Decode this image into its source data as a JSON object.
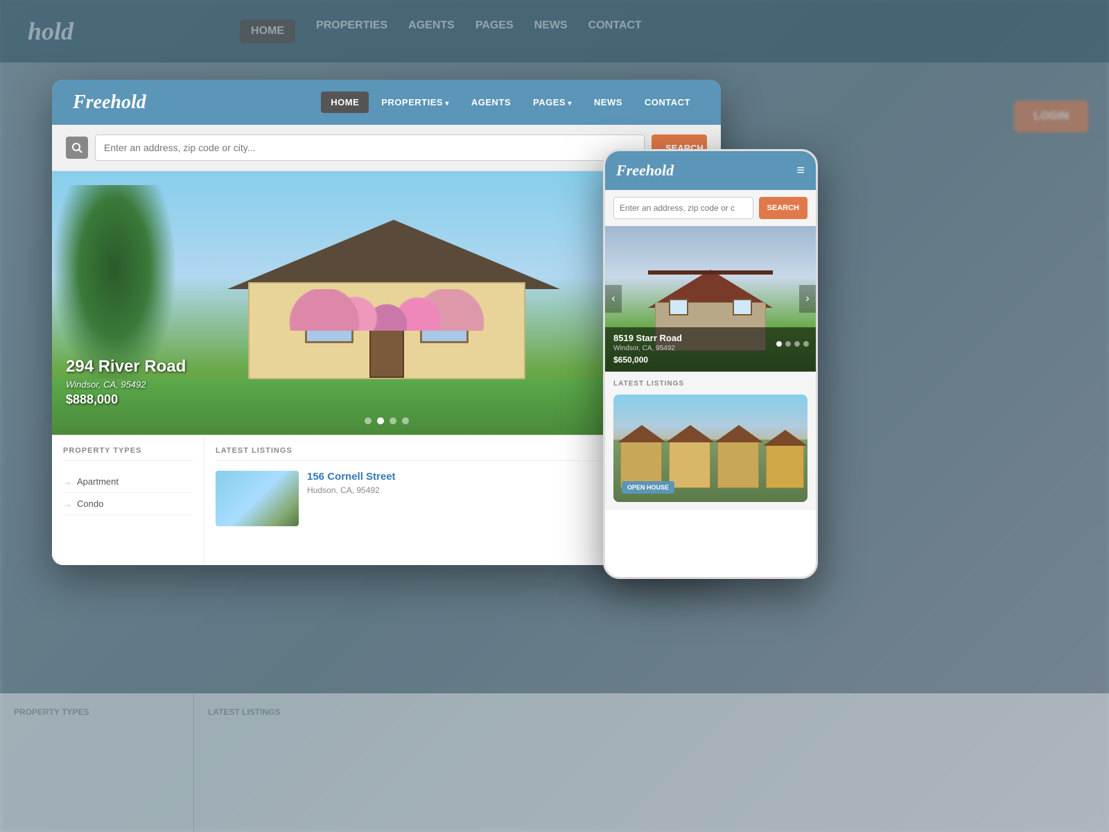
{
  "brand": {
    "name": "Freehold"
  },
  "background_nav": {
    "logo": "hold",
    "items": [
      {
        "label": "HOME",
        "active": true
      },
      {
        "label": "PROPERTIES",
        "has_arrow": true
      },
      {
        "label": "AGENTS"
      },
      {
        "label": "PAGES",
        "has_arrow": true
      },
      {
        "label": "NEWS"
      },
      {
        "label": "CONTACT"
      }
    ]
  },
  "desktop": {
    "nav": {
      "logo": "Freehold",
      "items": [
        {
          "label": "HOME",
          "active": true
        },
        {
          "label": "PROPERTIES",
          "has_arrow": true
        },
        {
          "label": "AGENTS"
        },
        {
          "label": "PAGES",
          "has_arrow": true
        },
        {
          "label": "NEWS"
        },
        {
          "label": "CONTACT"
        }
      ]
    },
    "search": {
      "placeholder": "Enter an address, zip code or city...",
      "button_label": "SEARCH"
    },
    "hero": {
      "address": "294 River Road",
      "location": "Windsor, CA, 95492",
      "price": "$888,000",
      "dots": [
        1,
        2,
        3,
        4
      ],
      "active_dot": 1
    },
    "property_types": {
      "title": "PROPERTY TYPES",
      "items": [
        {
          "label": "Apartment"
        },
        {
          "label": "Condo"
        }
      ]
    },
    "latest_listings": {
      "title": "LATEST LISTINGS",
      "items": [
        {
          "address": "156 Cornell Street",
          "location": "Hudson, CA, 95492"
        }
      ]
    }
  },
  "mobile": {
    "nav": {
      "logo": "Freehold",
      "menu_icon": "≡"
    },
    "search": {
      "placeholder": "Enter an address, zip code or c",
      "button_label": "SEARCH"
    },
    "hero": {
      "address": "8519 Starr Road",
      "location": "Windsor, CA, 95492",
      "price": "$650,000",
      "dots": [
        1,
        2,
        3,
        4
      ],
      "active_dot": 0
    },
    "latest_listings": {
      "title": "LATEST LISTINGS",
      "badge": "OPEN HOUSE"
    }
  },
  "cta_button": "LOGIN",
  "colors": {
    "brand_blue": "#5b95b7",
    "cta_orange": "#e07848",
    "dark_nav": "#555555",
    "text_dark": "#333333",
    "text_muted": "#888888"
  }
}
